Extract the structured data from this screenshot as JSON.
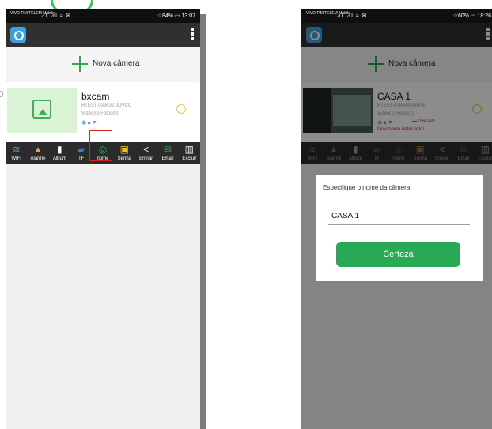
{
  "left_phone": {
    "status_bar": {
      "carrier": "VIVO\nTIM TELEM Mobile",
      "signal": "⊿l ⊿l ≈ ✉",
      "right": "☆84% ▭ 13:07"
    },
    "add_camera_label": "Nova câmera",
    "camera": {
      "name": "bxcam",
      "uid": "RTEST-039632-JDVCC",
      "counts": "Video(0) Fotos(0)",
      "status_icons": "◉▲▼"
    },
    "toolbar": [
      {
        "label": "WIFI",
        "icon": "wifi-icon",
        "glyph": "≋",
        "color": "#3fa0e0"
      },
      {
        "label": "Alarme",
        "icon": "bell-icon",
        "glyph": "▲",
        "color": "#f2a12a"
      },
      {
        "label": "Album",
        "icon": "album-icon",
        "glyph": "▮",
        "color": "#ffffff"
      },
      {
        "label": "TF",
        "icon": "sd-card-icon",
        "glyph": "▰",
        "color": "#3e6fe0"
      },
      {
        "label": "nome",
        "icon": "rename-icon",
        "glyph": "◎",
        "color": "#2eaa4e"
      },
      {
        "label": "Senha",
        "icon": "lock-icon",
        "glyph": "▣",
        "color": "#f0c020"
      },
      {
        "label": "Enviar",
        "icon": "share-icon",
        "glyph": "<",
        "color": "#ffffff"
      },
      {
        "label": "Email",
        "icon": "mail-icon",
        "glyph": "✉",
        "color": "#2eaa4e"
      },
      {
        "label": "Excluir",
        "icon": "trash-icon",
        "glyph": "▥",
        "color": "#ffffff"
      }
    ]
  },
  "right_phone": {
    "status_bar": {
      "carrier": "VIVO\nTIM TELEM Mobile",
      "signal": "⊿l ⊿l ≈ ✉",
      "right": "☆60% ▭ 18:26"
    },
    "add_camera_label": "Nova câmera",
    "camera": {
      "name": "CASA 1",
      "uid": "RTEST-038644-IGRSP",
      "counts": "Video(1) Fotos(1)",
      "status_icons": "◉▲▼",
      "storage": "▬ 0.6/14G",
      "motion": "Movimento detectado!"
    },
    "toolbar": [
      {
        "label": "WIFI",
        "icon": "wifi-icon",
        "glyph": "≋",
        "color": "#3fa0e0"
      },
      {
        "label": "Alarme",
        "icon": "bell-icon",
        "glyph": "▲",
        "color": "#f2a12a"
      },
      {
        "label": "Album",
        "icon": "album-icon",
        "glyph": "▮",
        "color": "#ffffff"
      },
      {
        "label": "TF",
        "icon": "sd-card-icon",
        "glyph": "▰",
        "color": "#3e6fe0"
      },
      {
        "label": "nome",
        "icon": "rename-icon",
        "glyph": "◎",
        "color": "#2eaa4e"
      },
      {
        "label": "Senha",
        "icon": "lock-icon",
        "glyph": "▣",
        "color": "#f0c020"
      },
      {
        "label": "Enviar",
        "icon": "share-icon",
        "glyph": "<",
        "color": "#ffffff"
      },
      {
        "label": "Email",
        "icon": "mail-icon",
        "glyph": "✉",
        "color": "#2eaa4e"
      },
      {
        "label": "Excluir",
        "icon": "trash-icon",
        "glyph": "▥",
        "color": "#ffffff"
      }
    ],
    "dialog": {
      "title": "Especifique o nome da câmera",
      "value": "CASA 1",
      "button": "Certeza"
    }
  }
}
